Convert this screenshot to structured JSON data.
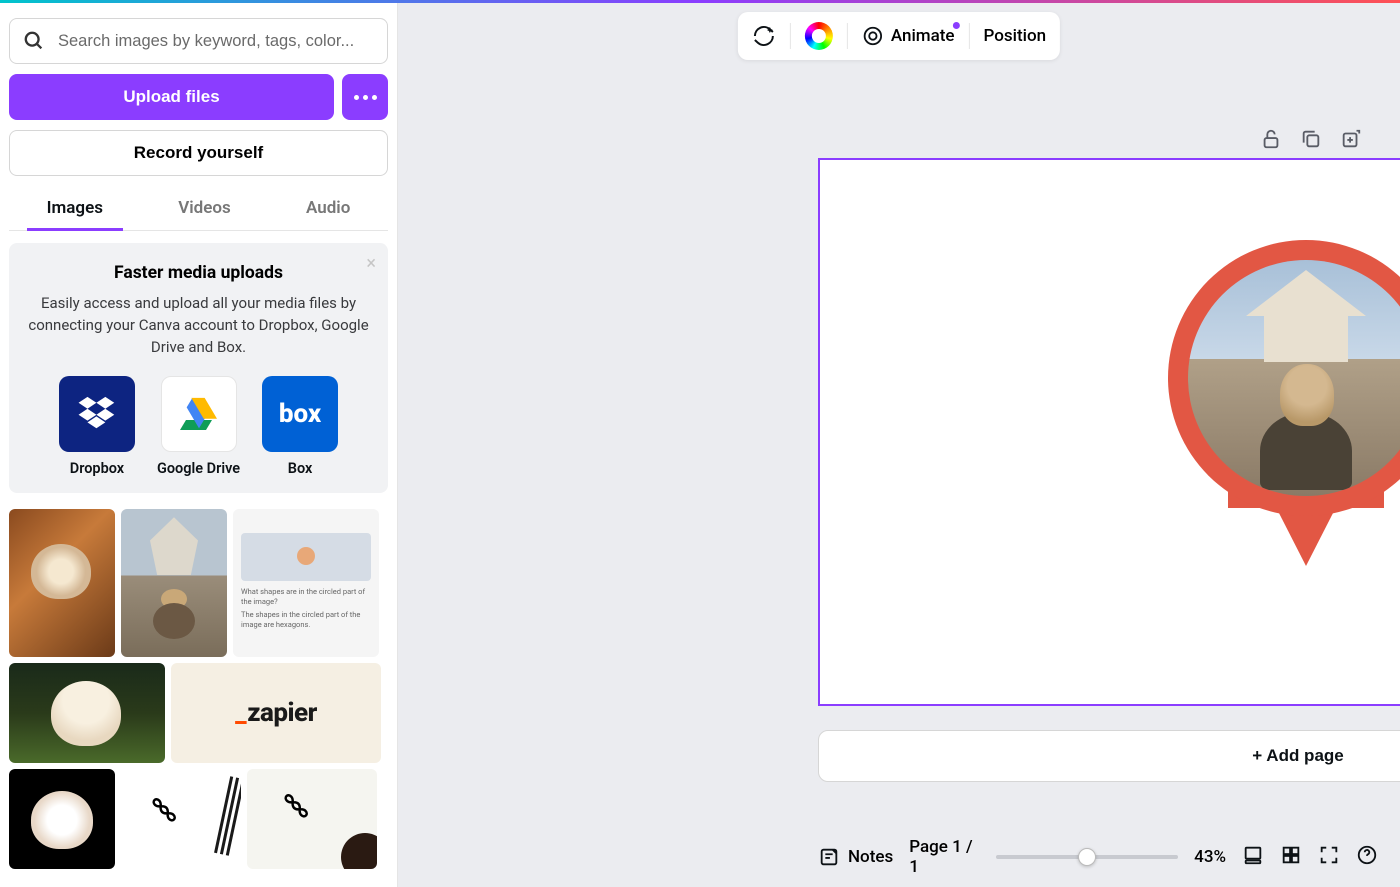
{
  "sidebar": {
    "search_placeholder": "Search images by keyword, tags, color...",
    "upload_label": "Upload files",
    "record_label": "Record yourself",
    "tabs": {
      "images": "Images",
      "videos": "Videos",
      "audio": "Audio"
    },
    "promo": {
      "title": "Faster media uploads",
      "desc": "Easily access and upload all your media files by connecting your Canva account to Dropbox, Google Drive and Box.",
      "services": {
        "dropbox": "Dropbox",
        "gdrive": "Google Drive",
        "box": "Box",
        "box_logo": "box"
      }
    },
    "thumbs": {
      "zapier": "zapier",
      "chat_q": "What shapes are in the circled part of the image?",
      "chat_a": "The shapes in the circled part of the image are hexagons."
    }
  },
  "toolbar": {
    "animate": "Animate",
    "position": "Position"
  },
  "canvas": {
    "add_page": "+ Add page"
  },
  "footer": {
    "notes": "Notes",
    "page_indicator": "Page 1 / 1",
    "zoom": "43%"
  }
}
